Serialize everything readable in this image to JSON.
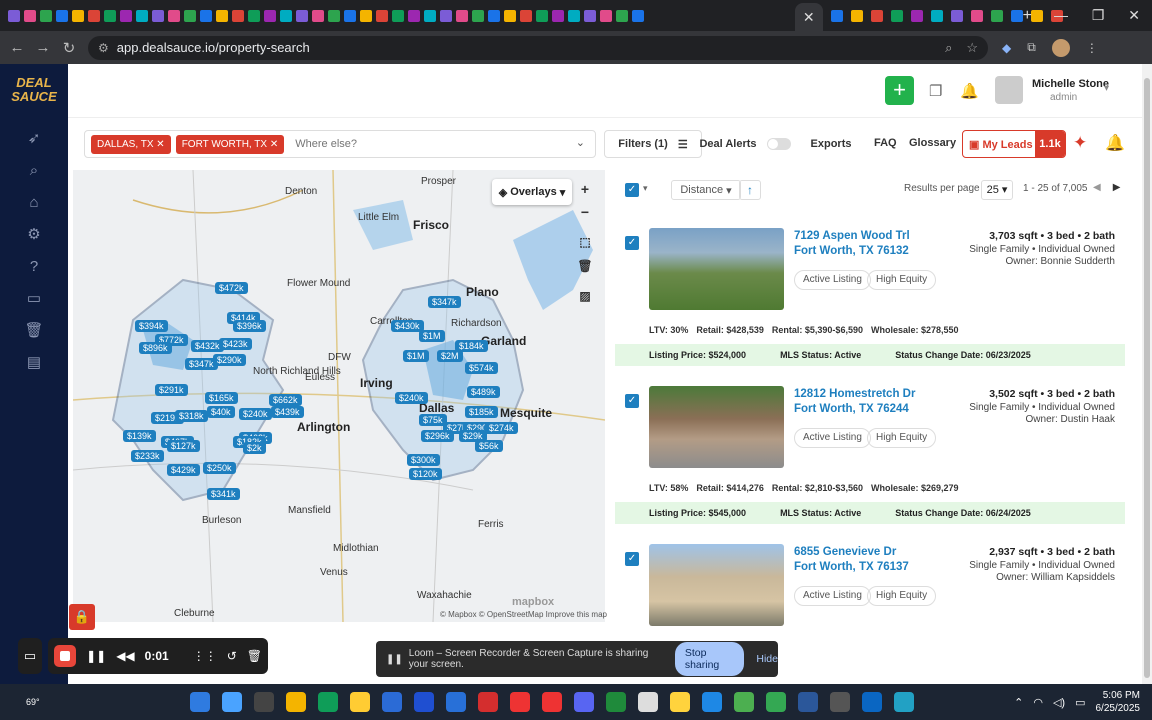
{
  "browser": {
    "url": "app.dealsauce.io/property-search",
    "new_tab": "+"
  },
  "app": {
    "logo_text": "DEAL SAUCE",
    "user": {
      "name": "Michelle Stone",
      "role": "admin"
    }
  },
  "search": {
    "chips": [
      "DALLAS, TX",
      "FORT WORTH, TX"
    ],
    "placeholder": "Where else?"
  },
  "toolbar": {
    "filters_label": "Filters (1)",
    "deal_alerts_label": "Deal Alerts",
    "exports_label": "Exports",
    "faq_label": "FAQ",
    "glossary_label": "Glossary",
    "my_leads_label": "My Leads",
    "my_leads_count": "1.1k"
  },
  "map": {
    "overlays_label": "Overlays",
    "attribution": "© Mapbox © OpenStreetMap Improve this map",
    "logo": "mapbox",
    "places": [
      {
        "name": "Prosper",
        "cls": ""
      },
      {
        "name": "Frisco",
        "cls": "big"
      },
      {
        "name": "Little Elm",
        "cls": ""
      },
      {
        "name": "Denton",
        "cls": ""
      },
      {
        "name": "Flower Mound",
        "cls": ""
      },
      {
        "name": "Plano",
        "cls": "big"
      },
      {
        "name": "Carrollton",
        "cls": ""
      },
      {
        "name": "Richardson",
        "cls": ""
      },
      {
        "name": "Garland",
        "cls": "big"
      },
      {
        "name": "North Richland Hills",
        "cls": ""
      },
      {
        "name": "Euless",
        "cls": ""
      },
      {
        "name": "Irving",
        "cls": "big"
      },
      {
        "name": "Dallas",
        "cls": "big"
      },
      {
        "name": "Mesquite",
        "cls": "big"
      },
      {
        "name": "Arlington",
        "cls": "big"
      },
      {
        "name": "Burleson",
        "cls": ""
      },
      {
        "name": "Mansfield",
        "cls": ""
      },
      {
        "name": "Ferris",
        "cls": ""
      },
      {
        "name": "Midlothian",
        "cls": ""
      },
      {
        "name": "Venus",
        "cls": ""
      },
      {
        "name": "Waxahachie",
        "cls": ""
      },
      {
        "name": "Cleburne",
        "cls": ""
      },
      {
        "name": "DFW",
        "cls": ""
      }
    ],
    "pins": [
      "$472k",
      "$394k",
      "$414k",
      "$396k",
      "$772k",
      "$432k",
      "$423k",
      "$896k",
      "$347k",
      "$290k",
      "$291k",
      "$165k",
      "$219k",
      "$318k",
      "$40k",
      "$439k",
      "$662k",
      "$240k",
      "$139k",
      "$467k",
      "$462k",
      "$127k",
      "$182k",
      "$233k",
      "$429k",
      "$250k",
      "$341k",
      "$430k",
      "$347k",
      "$1M",
      "$1M",
      "$2M",
      "$184k",
      "$574k",
      "$489k",
      "$240k",
      "$185k",
      "$75k",
      "$27k",
      "$290k",
      "$274k",
      "$296k",
      "$29k",
      "$56k",
      "$300k",
      "$120k",
      "$2k"
    ]
  },
  "results": {
    "sort_label": "Distance",
    "results_per_page_label": "Results per page",
    "results_per_page": "25",
    "range": "1 - 25 of 7,005"
  },
  "properties": [
    {
      "address_line1": "7129 Aspen Wood Trl",
      "address_line2": "Fort Worth, TX 76132",
      "specs": "3,703 sqft • 3 bed • 2 bath",
      "type": "Single Family • Individual Owned",
      "owner": "Owner: Bonnie Sudderth",
      "badges": [
        "Active Listing",
        "High Equity"
      ],
      "ltv": "LTV: 30%",
      "retail": "Retail: $428,539",
      "rental": "Rental: $5,390-$6,590",
      "wholesale": "Wholesale: $278,550",
      "listing_price": "Listing Price: $524,000",
      "mls_status": "MLS Status: Active",
      "status_change": "Status Change Date: 06/23/2025"
    },
    {
      "address_line1": "12812 Homestretch Dr",
      "address_line2": "Fort Worth, TX 76244",
      "specs": "3,502 sqft • 3 bed • 2 bath",
      "type": "Single Family • Individual Owned",
      "owner": "Owner: Dustin Haak",
      "badges": [
        "Active Listing",
        "High Equity"
      ],
      "ltv": "LTV: 58%",
      "retail": "Retail: $414,276",
      "rental": "Rental: $2,810-$3,560",
      "wholesale": "Wholesale: $269,279",
      "listing_price": "Listing Price: $545,000",
      "mls_status": "MLS Status: Active",
      "status_change": "Status Change Date: 06/24/2025"
    },
    {
      "address_line1": "6855 Genevieve Dr",
      "address_line2": "Fort Worth, TX 76137",
      "specs": "2,937 sqft • 3 bed • 2 bath",
      "type": "Single Family • Individual Owned",
      "owner": "Owner: William Kapsiddels",
      "badges": [
        "Active Listing",
        "High Equity"
      ]
    }
  ],
  "loom": {
    "timer": "0:01",
    "banner_text": "Loom – Screen Recorder & Screen Capture is sharing your screen.",
    "stop_label": "Stop sharing",
    "hide_label": "Hide"
  },
  "taskbar": {
    "weather": "69°",
    "time": "5:06 PM",
    "date": "6/25/2025"
  },
  "colors": {
    "brand_red": "#d83a2a",
    "sidebar_navy": "#0d1b3d",
    "link_blue": "#1e7fbf",
    "green_add": "#22b24c",
    "status_green": "#e4f7e4"
  }
}
